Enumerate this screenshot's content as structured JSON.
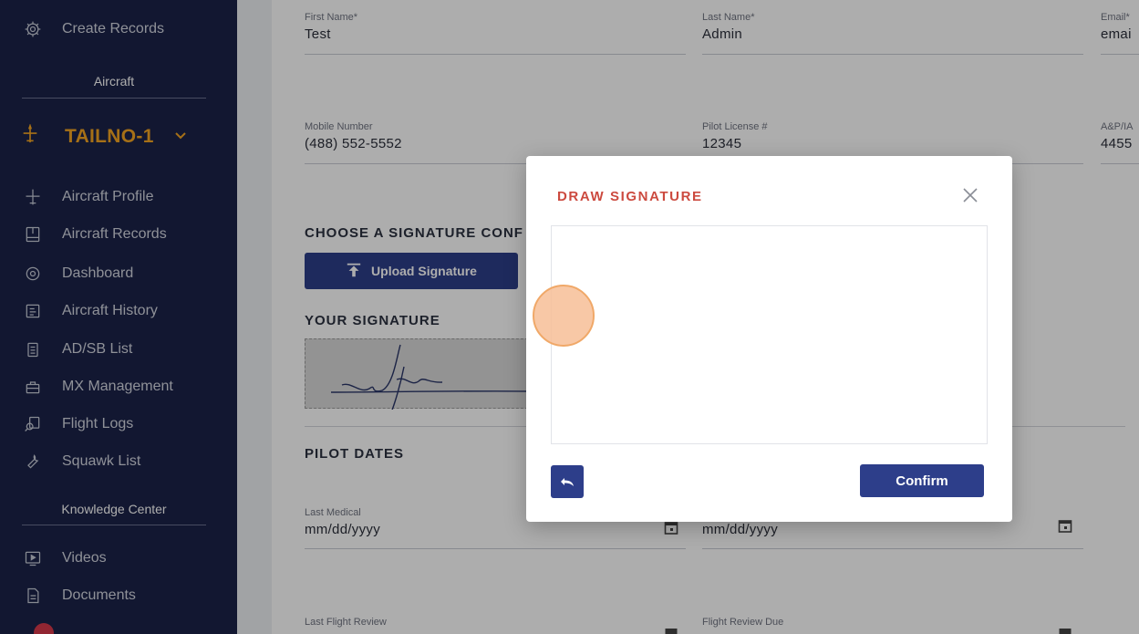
{
  "sidebar": {
    "top_item": {
      "label": "Create Records",
      "icon": "gear-icon"
    },
    "section_aircraft": "Aircraft",
    "tail_number": "TAILNO-1",
    "items": [
      {
        "label": "Aircraft Profile",
        "icon": "airplane-icon"
      },
      {
        "label": "Aircraft Records",
        "icon": "logbook-icon"
      },
      {
        "label": "Dashboard",
        "icon": "dashboard-icon"
      },
      {
        "label": "Aircraft History",
        "icon": "history-icon"
      },
      {
        "label": "AD/SB List",
        "icon": "clipboard-icon"
      },
      {
        "label": "MX Management",
        "icon": "toolbox-icon"
      },
      {
        "label": "Flight Logs",
        "icon": "flight-log-icon"
      },
      {
        "label": "Squawk List",
        "icon": "wrench-icon"
      }
    ],
    "section_knowledge": "Knowledge Center",
    "knowledge_items": [
      {
        "label": "Videos",
        "icon": "video-icon"
      },
      {
        "label": "Documents",
        "icon": "document-icon"
      }
    ]
  },
  "form": {
    "first_name": {
      "label": "First Name*",
      "value": "Test"
    },
    "last_name": {
      "label": "Last Name*",
      "value": "Admin"
    },
    "email": {
      "label": "Email*",
      "value": "emai"
    },
    "mobile": {
      "label": "Mobile Number",
      "value": "(488) 552-5552"
    },
    "pilot_license": {
      "label": "Pilot License #",
      "value": "12345"
    },
    "ap_ia": {
      "label": "A&P/IA",
      "value": "4455"
    },
    "signature_heading": "CHOOSE A SIGNATURE CONF",
    "upload_label": "Upload Signature",
    "your_signature": "YOUR SIGNATURE",
    "pilot_dates": "PILOT DATES",
    "last_medical": {
      "label": "Last Medical",
      "value": "mm/dd/yyyy"
    },
    "medical_due": {
      "value": "mm/dd/yyyy"
    },
    "last_flight_review": {
      "label": "Last Flight Review"
    },
    "flight_review_due": {
      "label": "Flight Review Due"
    }
  },
  "modal": {
    "title": "DRAW SIGNATURE",
    "confirm_label": "Confirm",
    "close_icon": "close-icon",
    "undo_icon": "undo-icon"
  },
  "colors": {
    "sidebar_bg": "#1b2349",
    "accent_orange": "#f5a623",
    "primary_button": "#2d3e8a",
    "modal_title": "#cc4a3f"
  }
}
